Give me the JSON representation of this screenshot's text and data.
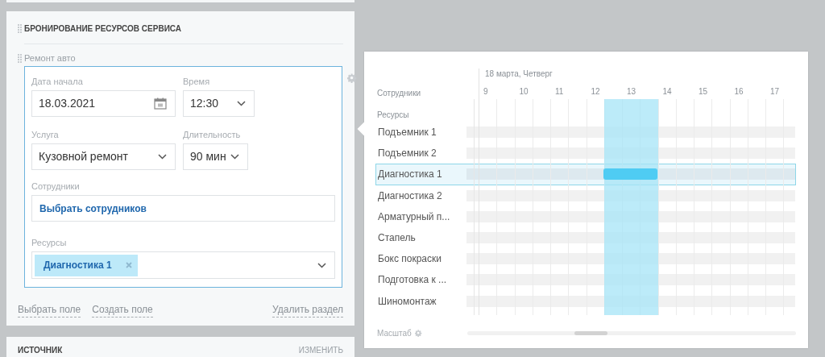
{
  "section": {
    "title": "БРОНИРОВАНИЕ РЕСУРСОВ СЕРВИСА",
    "subsection": "Ремонт авто",
    "field_rows": [
      [
        {
          "label": "Дата начала",
          "value": "18.03.2021",
          "kind": "date"
        },
        {
          "label": "Время",
          "value": "12:30",
          "kind": "select"
        }
      ],
      [
        {
          "label": "Услуга",
          "value": "Кузовной ремонт",
          "kind": "select"
        },
        {
          "label": "Длительность",
          "value": "90 мин",
          "kind": "select"
        }
      ]
    ],
    "employees": {
      "label": "Сотрудники",
      "action": "Выбрать сотрудников"
    },
    "resources": {
      "label": "Ресурсы",
      "chips": [
        "Диагностика 1"
      ]
    },
    "links": [
      "Выбрать поле",
      "Создать поле"
    ],
    "delete_link": "Удалить раздел"
  },
  "next_section": {
    "title": "ИСТОЧНИК",
    "action": "ИЗМЕНИТЬ"
  },
  "schedule": {
    "date": "18 марта, Четверг",
    "employees_label": "Сотрудники",
    "resources_label": "Ресурсы",
    "hours": [
      "9",
      "10",
      "11",
      "12",
      "13",
      "14",
      "15",
      "16",
      "17"
    ],
    "resources": [
      {
        "name": "Подъемник 1",
        "selected": false
      },
      {
        "name": "Подъемник 2",
        "selected": false
      },
      {
        "name": "Диагностика 1",
        "selected": true
      },
      {
        "name": "Диагностика 2",
        "selected": false
      },
      {
        "name": "Арматурный п...",
        "selected": false
      },
      {
        "name": "Стапель",
        "selected": false
      },
      {
        "name": "Бокс покраски",
        "selected": false
      },
      {
        "name": "Подготовка к ...",
        "selected": false
      },
      {
        "name": "Шиномонтаж",
        "selected": false
      }
    ],
    "scale_label": "Масштаб"
  }
}
